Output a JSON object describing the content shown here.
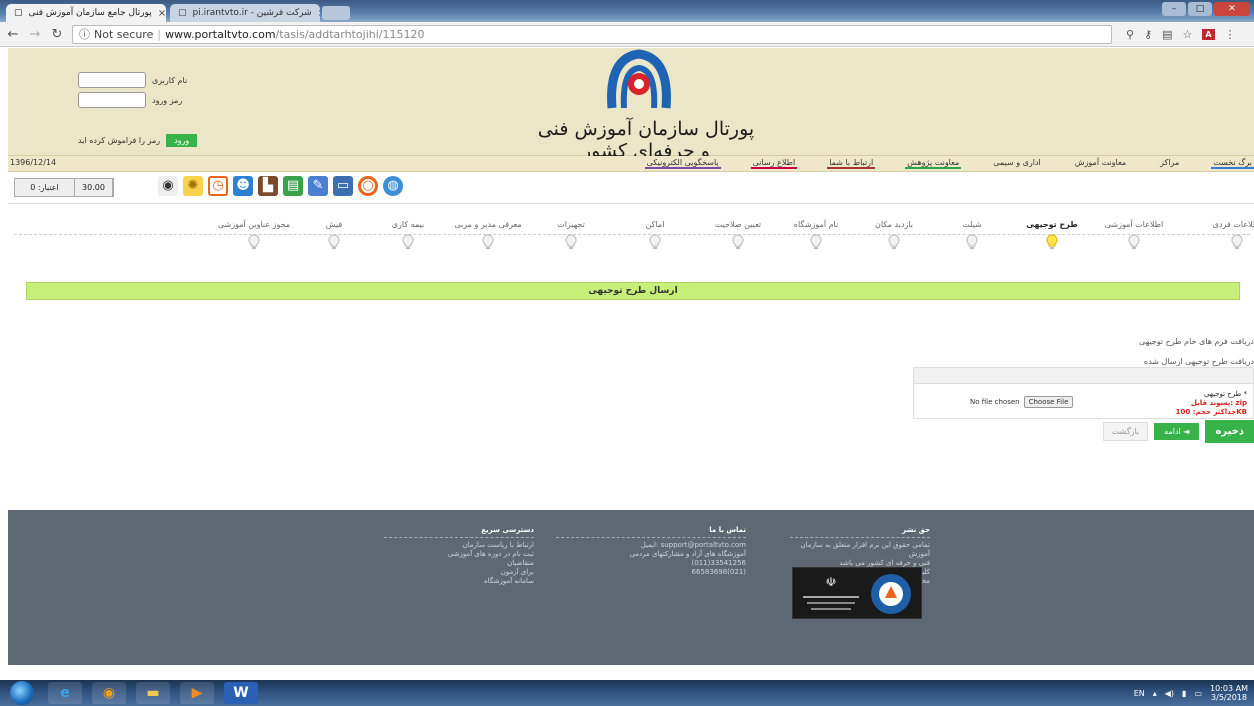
{
  "browser": {
    "tabs": [
      {
        "title": "پورتال جامع سازمان آموزش فنی"
      },
      {
        "title": "pi.irantvto.ir - شرکت فرشین"
      }
    ],
    "url": {
      "info_icon": "info-icon",
      "not_secure": "Not secure",
      "host": "www.portaltvto.com",
      "path": "/tasis/addtarhtojihi/115120"
    }
  },
  "header": {
    "login": {
      "username_label": "نام کاربری",
      "password_label": "رمز ورود",
      "login_button": "ورود",
      "forgot_label": "رمز را فراموش کرده اید"
    },
    "site_title": "پورتال سازمان آموزش فنی و حرفه‌ای کشور"
  },
  "menu": {
    "date": "1396/12/14",
    "items": [
      "برگ نخست",
      "مراکز",
      "معاونت آموزش",
      "اداری و سیمی",
      "معاونت پژوهش",
      "ارتباط با شما",
      "اطلاع رسانی",
      "پاسخگویی الکترونیکی"
    ]
  },
  "toolbar": {
    "credit_label": "اعتبار: 0",
    "credit_value": "30.00"
  },
  "steps": [
    {
      "label": "اطلاعات فردی",
      "active": false
    },
    {
      "label": "اطلاعات آموزشی",
      "active": false
    },
    {
      "label": "طرح توجیهی",
      "active": true
    },
    {
      "label": "شیلت",
      "active": false
    },
    {
      "label": "بازدید مکان",
      "active": false
    },
    {
      "label": "نام آموزشگاه",
      "active": false
    },
    {
      "label": "تعیین صلاحیت",
      "active": false
    },
    {
      "label": "اماکن",
      "active": false
    },
    {
      "label": "تجهیزات",
      "active": false
    },
    {
      "label": "معرفی مدیر و مربی",
      "active": false
    },
    {
      "label": "بیمه کاری",
      "active": false
    },
    {
      "label": "فیش",
      "active": false
    },
    {
      "label": "مجوز عناوین آموزشی",
      "active": false
    }
  ],
  "main": {
    "banner": "ارسال طرح توجیهی",
    "link1": "دریافت فرم های خام طرح توجیهی",
    "link2": "دریافت طرح توجیهی ارسال شده",
    "form": {
      "field_label": "طرح توجیهی *",
      "hint1": "پسوند فایل: zip",
      "hint2": "حداکثر حجم: 100KB",
      "no_file": "No file chosen",
      "choose_file": "Choose File"
    },
    "buttons": {
      "save": "ذخیره",
      "next": "ادامه ◄",
      "back": "بازگشت"
    }
  },
  "footer": {
    "col1_title": "حق نشر",
    "col1_text": "تمامی حقوق این نرم افزار متعلق به سازمان آموزش\nفنی و حرفه ای کشور می باشد\nکلیه حقوق مادی و معنوی آموزش 96-89\nمحفوظ است",
    "col2_title": "تماس با ما",
    "col2_text": "ایمیل: support@portaltvto.com\nآموزشگاه های آزاد و مشارکتهای مردمی\n(011)33541256\n66583698(021)",
    "col3_title": "دسترسی سریع",
    "col3_text": "ارتباط با ریاست سازمان\nثبت نام در دوره های آموزشی\nمتقاضیان\nبرای آزمون\nسامانه آموزشگاه"
  },
  "taskbar": {
    "lang": "EN",
    "time": "10:03 AM",
    "date": "3/5/2018"
  }
}
